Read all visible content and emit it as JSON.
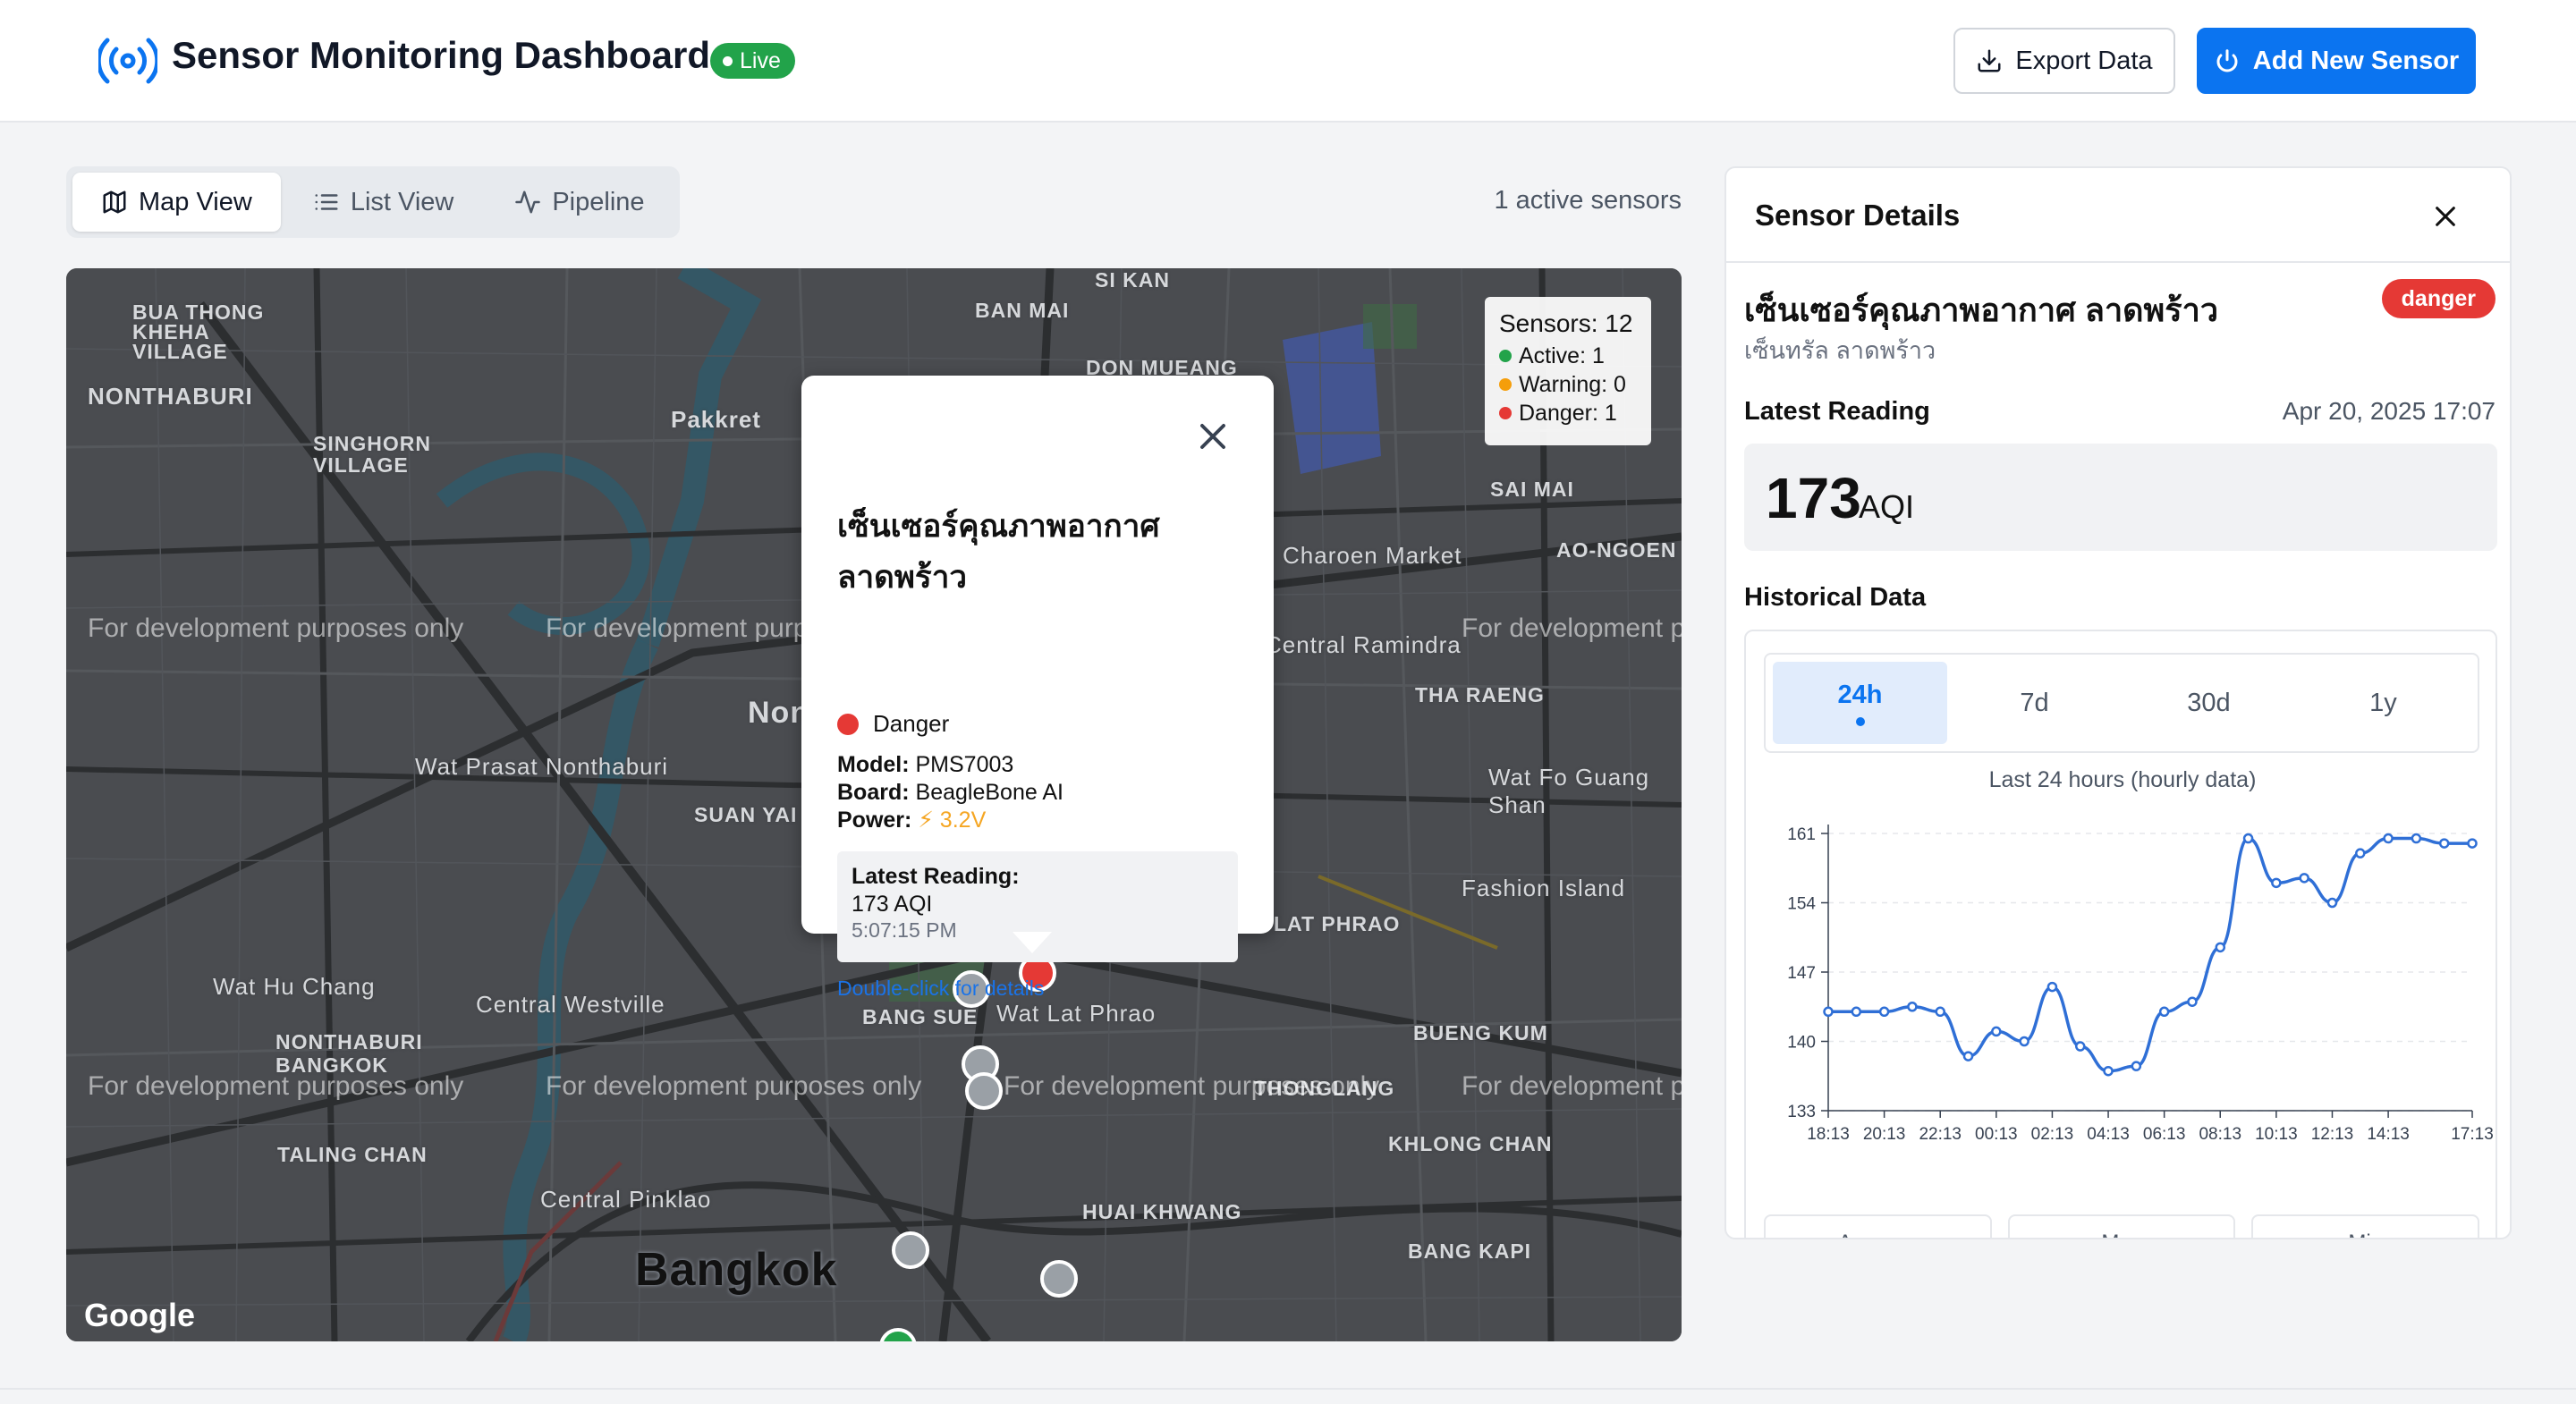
{
  "header": {
    "title": "Sensor Monitoring Dashboard",
    "live_badge": "Live",
    "export_label": "Export Data",
    "add_label": "Add New Sensor"
  },
  "view_tabs": [
    {
      "label": "Map View",
      "icon": "map-icon",
      "active": true
    },
    {
      "label": "List View",
      "icon": "list-icon",
      "active": false
    },
    {
      "label": "Pipeline",
      "icon": "activity-icon",
      "active": false
    }
  ],
  "active_sensors_text": "1 active sensors",
  "map": {
    "labels": [
      "BUA THONG KHEHA VILLAGE",
      "NONTHABURI",
      "SINGHORN VILLAGE",
      "Pakkret",
      "BAN MAI",
      "SI KAN",
      "DON MUEANG",
      "SAI MAI",
      "AO-NGOEN",
      "Charoen Market",
      "Central Ramindra",
      "THA RAENG",
      "Wat Prasat Nonthaburi",
      "SUAN YAI",
      "Nonthaburi",
      "Wat Fo Guang Shan",
      "Fashion Island",
      "Wat Hu Chang",
      "Central Westville",
      "NONTHABURI BANGKOK",
      "BANG SUE",
      "Wat Lat Phrao",
      "BUENG KUM",
      "THONGLANG",
      "KHLONG CHAN",
      "TALING CHAN",
      "Central Pinklao",
      "HUAI KHWANG",
      "BANG KAPI",
      "Bangkok",
      "LAT PHRAO"
    ],
    "watermark": "For development purposes only",
    "google": "Google",
    "legend": {
      "title": "Sensors: 12",
      "active": "Active: 1",
      "warning": "Warning: 0",
      "danger": "Danger: 1",
      "colors": {
        "active": "#22a34a",
        "warning": "#f59e0b",
        "danger": "#e53935"
      }
    },
    "popup": {
      "title": "เซ็นเซอร์คุณภาพอากาศ ลาดพร้าว",
      "status": "Danger",
      "model_label": "Model:",
      "model": "PMS7003",
      "board_label": "Board:",
      "board": "BeagleBone AI",
      "power_label": "Power:",
      "power": "⚡ 3.2V",
      "reading_label": "Latest Reading:",
      "reading_value": "173 AQI",
      "reading_time": "5:07:15 PM",
      "link": "Double-click for details"
    }
  },
  "details": {
    "title": "Sensor Details",
    "sensor_name": "เซ็นเซอร์คุณภาพอากาศ ลาดพร้าว",
    "location": "เซ็นทรัล ลาดพร้าว",
    "status": "danger",
    "latest_label": "Latest Reading",
    "latest_time": "Apr 20, 2025 17:07",
    "aqi_value": "173",
    "aqi_unit": "AQI",
    "historical_label": "Historical Data",
    "ranges": [
      "24h",
      "7d",
      "30d",
      "1y"
    ],
    "selected_range": "24h",
    "chart_caption": "Last 24 hours (hourly data)",
    "stat_cards": [
      "Average",
      "Max",
      "Min"
    ]
  },
  "chart_data": {
    "type": "line",
    "title": "Last 24 hours (hourly data)",
    "x": [
      "18:13",
      "19:13",
      "20:13",
      "21:13",
      "22:13",
      "23:13",
      "00:13",
      "01:13",
      "02:13",
      "03:13",
      "04:13",
      "05:13",
      "06:13",
      "07:13",
      "08:13",
      "09:13",
      "10:13",
      "11:13",
      "12:13",
      "13:13",
      "14:13",
      "15:13",
      "16:13",
      "17:13"
    ],
    "xticks": [
      "18:13",
      "20:13",
      "22:13",
      "00:13",
      "02:13",
      "04:13",
      "06:13",
      "08:13",
      "10:13",
      "12:13",
      "14:13",
      "17:13"
    ],
    "series": [
      {
        "values": [
          143,
          143,
          143,
          143.5,
          143,
          138.5,
          141,
          140,
          145.5,
          139.5,
          137,
          137.5,
          143,
          144,
          149.5,
          160.5,
          156,
          156.5,
          154,
          159,
          160.5,
          160.5,
          160,
          160
        ]
      }
    ],
    "ylim": [
      133,
      161
    ],
    "yticks": [
      133,
      140,
      147,
      154,
      161
    ],
    "color": "#2f6fd6",
    "grid": "horizontal dashed"
  }
}
